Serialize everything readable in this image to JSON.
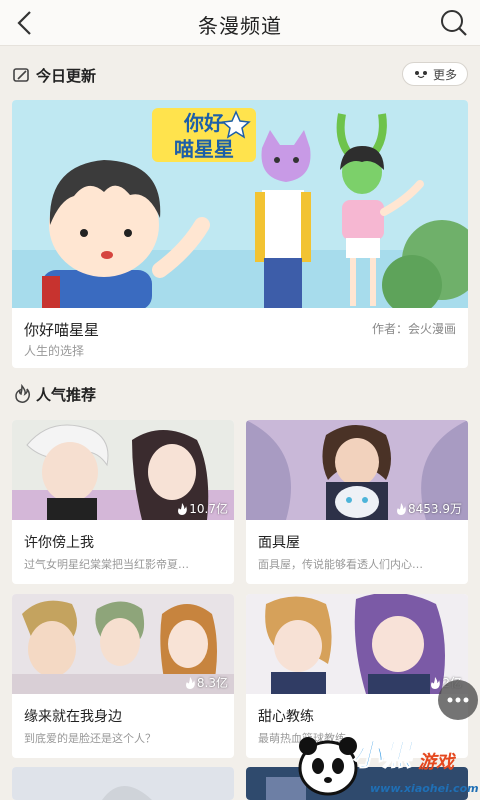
{
  "header": {
    "title": "条漫频道",
    "back_icon": "chevron-left-icon",
    "search_icon": "search-icon"
  },
  "today": {
    "title": "今日更新",
    "more_label": "更多",
    "featured": {
      "art_title": "你好喵星星",
      "name": "你好喵星星",
      "author": "作者：会火漫画",
      "tagline": "人生的选择"
    }
  },
  "popular": {
    "title": "人气推荐",
    "items": [
      {
        "name": "许你傍上我",
        "views": "10.7亿",
        "desc": "过气女明星纪棠棠把当红影帝夏…"
      },
      {
        "name": "面具屋",
        "views": "8453.9万",
        "desc": "面具屋，传说能够看透人们内心…"
      },
      {
        "name": "缘来就在我身边",
        "views": "8.3亿",
        "desc": "到底爱的是脸还是这个人？"
      },
      {
        "name": "甜心教练",
        "views": "2亿",
        "desc": "最萌热血篮球教练"
      }
    ]
  },
  "watermark": {
    "brand": "小黑",
    "brand2": "游戏",
    "url": "www.xiaohei.com"
  },
  "colors": {
    "accent": "#1f8fe0",
    "background": "#f2efea"
  }
}
